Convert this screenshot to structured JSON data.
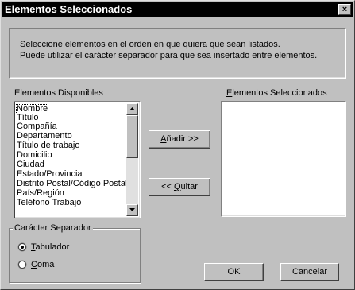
{
  "window": {
    "title": "Elementos Seleccionados",
    "close_glyph": "×"
  },
  "info": {
    "line1": "Seleccione elementos en el orden en que quiera que sean listados.",
    "line2": "Puede utilizar el carácter separador para que sea insertado entre elementos."
  },
  "available": {
    "label": "Elementos Disponibles",
    "items": [
      "Nombre",
      "Título",
      "Compañía",
      "Departamento",
      "Título de trabajo",
      "Domicilio",
      "Ciudad",
      "Estado/Provincia",
      "Distrito Postal/Código Postal",
      "País/Región",
      "Teléfono Trabajo"
    ],
    "selected_item": "Nombre"
  },
  "selected": {
    "label_accel": "E",
    "label_rest": "lementos Seleccionados",
    "items": []
  },
  "buttons": {
    "add_accel": "A",
    "add_rest": "ñadir >>",
    "remove_prefix": "<< ",
    "remove_accel": "Q",
    "remove_rest": "uitar",
    "ok": "OK",
    "cancel": "Cancelar"
  },
  "separator": {
    "label": "Carácter Separador",
    "tab_accel": "T",
    "tab_rest": "abulador",
    "comma_accel": "C",
    "comma_rest": "oma",
    "selected": "Tabulador"
  },
  "icons": {
    "close": "close-icon",
    "scroll_up": "arrow-up-icon",
    "scroll_down": "arrow-down-icon",
    "radio_on": "radio-selected-icon",
    "radio_off": "radio-unselected-icon"
  },
  "colors": {
    "titlebar": "#000000",
    "face": "#c0c0c0",
    "list_bg": "#ffffff"
  }
}
